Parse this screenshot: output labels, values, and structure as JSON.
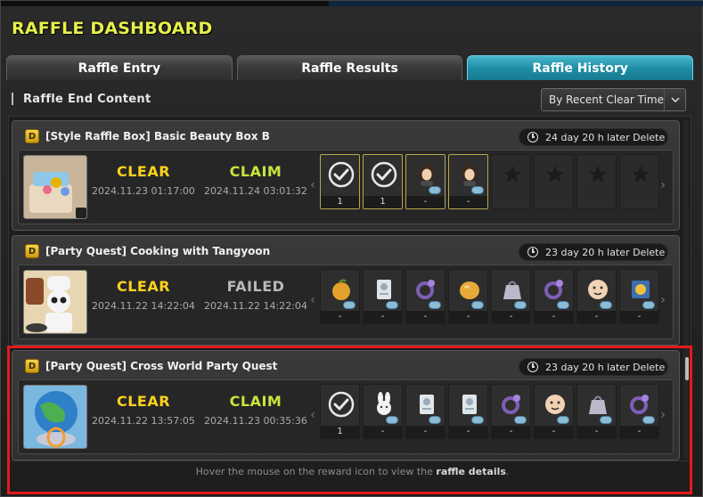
{
  "window": {
    "title": "RAFFLE DASHBOARD"
  },
  "tabs": [
    {
      "label": "Raffle Entry",
      "active": false
    },
    {
      "label": "Raffle Results",
      "active": false
    },
    {
      "label": "Raffle History",
      "active": true
    }
  ],
  "section": {
    "label": "Raffle End Content"
  },
  "sort": {
    "selected": "By Recent Clear Time"
  },
  "cards": [
    {
      "badge": "D",
      "title": "[Style Raffle Box] Basic Beauty Box B",
      "timer": "24 day 20 h later Delete",
      "thumb_icon": "beauty-box-icon",
      "thumb_label": "BASIC",
      "thumb_tag": "B",
      "left_status": "CLEAR",
      "left_date": "2024.11.23 01:17:00",
      "right_status": "CLAIM",
      "right_date": "2024.11.24 03:01:32",
      "slots": [
        {
          "icon": "check-icon",
          "count": "1",
          "owned": true
        },
        {
          "icon": "check-icon",
          "count": "1",
          "owned": true
        },
        {
          "icon": "hair-style-icon",
          "count": "-",
          "owned": true
        },
        {
          "icon": "hair-style-icon",
          "count": "-",
          "owned": true
        },
        {
          "icon": "star-icon",
          "count": "",
          "owned": false
        },
        {
          "icon": "star-icon",
          "count": "",
          "owned": false
        },
        {
          "icon": "star-icon",
          "count": "",
          "owned": false
        },
        {
          "icon": "star-icon",
          "count": "",
          "owned": false
        }
      ]
    },
    {
      "badge": "D",
      "title": "[Party Quest] Cooking with Tangyoon",
      "timer": "23 day 20 h later Delete",
      "thumb_icon": "chef-panda-icon",
      "left_status": "CLEAR",
      "left_date": "2024.11.22 14:22:04",
      "right_status": "FAILED",
      "right_date": "2024.11.22 14:22:04",
      "slots": [
        {
          "icon": "fruit-icon",
          "count": "-",
          "owned": false
        },
        {
          "icon": "scroll-icon",
          "count": "-",
          "owned": false
        },
        {
          "icon": "ring-icon",
          "count": "-",
          "owned": false
        },
        {
          "icon": "bun-icon",
          "count": "-",
          "owned": false
        },
        {
          "icon": "bag-icon",
          "count": "-",
          "owned": false
        },
        {
          "icon": "ring-icon",
          "count": "-",
          "owned": false
        },
        {
          "icon": "face-icon",
          "count": "-",
          "owned": false
        },
        {
          "icon": "card-icon",
          "count": "-",
          "owned": false
        }
      ]
    },
    {
      "badge": "D",
      "title": "[Party Quest] Cross World Party Quest",
      "timer": "23 day 20 h later Delete",
      "thumb_icon": "globe-portal-icon",
      "left_status": "CLEAR",
      "left_date": "2024.11.22 13:57:05",
      "right_status": "CLAIM",
      "right_date": "2024.11.23 00:35:36",
      "slots": [
        {
          "icon": "check-icon",
          "count": "1",
          "owned": false
        },
        {
          "icon": "bunny-icon",
          "count": "-",
          "owned": false
        },
        {
          "icon": "scroll-icon",
          "count": "-",
          "owned": false
        },
        {
          "icon": "scroll-icon",
          "count": "-",
          "owned": false
        },
        {
          "icon": "ring-icon",
          "count": "-",
          "owned": false
        },
        {
          "icon": "face-icon",
          "count": "-",
          "owned": false
        },
        {
          "icon": "bag-icon",
          "count": "-",
          "owned": false
        },
        {
          "icon": "ring-icon",
          "count": "-",
          "owned": false
        }
      ]
    }
  ],
  "footer": {
    "prefix": "Hover the mouse on the reward icon to view the ",
    "strong": "raffle details",
    "suffix": "."
  },
  "colors": {
    "title": "#e6f04a",
    "clear": "#ffd21c",
    "claim": "#c6e63a",
    "failed": "#b9b9b9",
    "active_tab": "#1f8ea6",
    "highlight": "#e21b1b"
  }
}
